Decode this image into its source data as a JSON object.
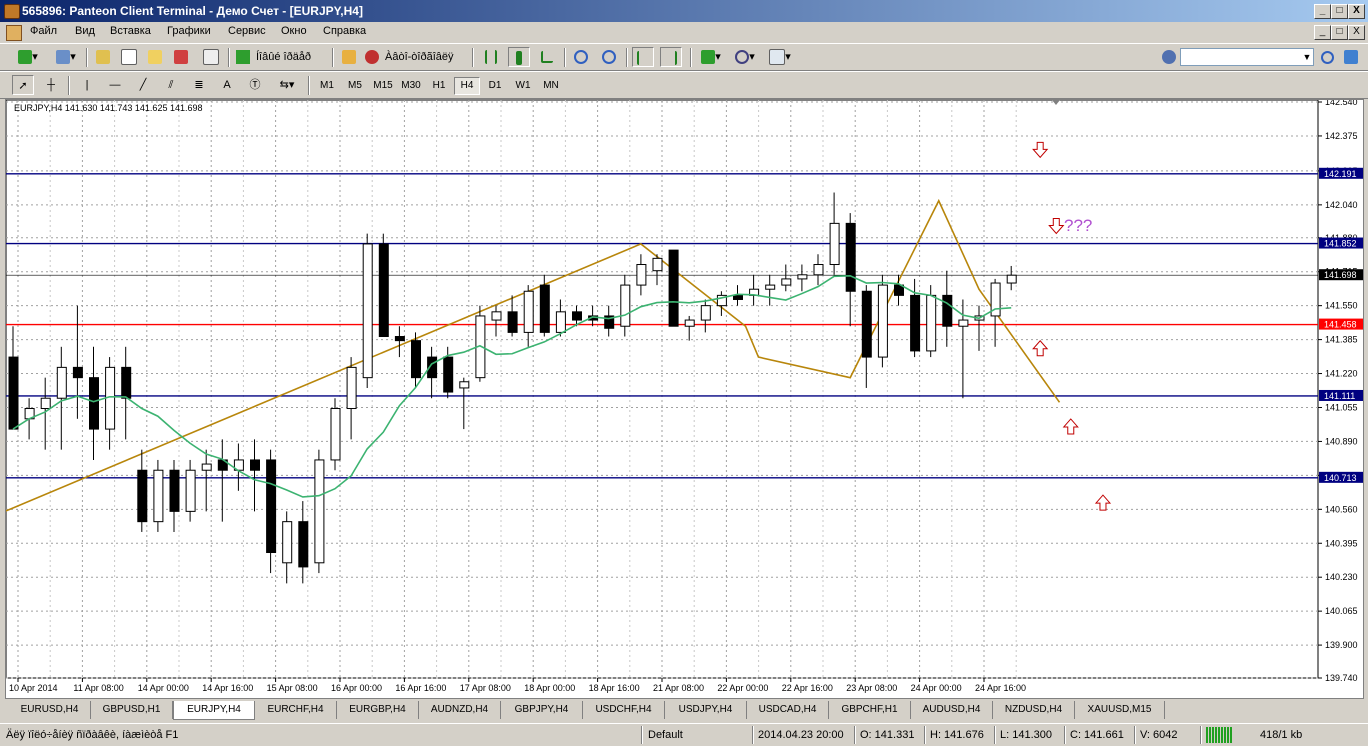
{
  "window": {
    "title": "565896: Panteon Client Terminal - Демо Счет - [EURJPY,H4]",
    "min_label": "_",
    "max_label": "□",
    "close_label": "X"
  },
  "menu": {
    "items": [
      "Файл",
      "Вид",
      "Вставка",
      "Графики",
      "Сервис",
      "Окно",
      "Справка"
    ]
  },
  "toolbar": {
    "new_order_label": "Íîâûé îðäåð",
    "autotrading_label": "Àâòî-òîðãîâëÿ",
    "timeframes": [
      "M1",
      "M5",
      "M15",
      "M30",
      "H1",
      "H4",
      "D1",
      "W1",
      "MN"
    ],
    "active_timeframe": "H4",
    "text_tool_label": "A"
  },
  "chart_data": {
    "type": "candlestick",
    "symbol_info": "EURJPY,H4  141.630 141.743 141.625 141.698",
    "y_ticks": [
      "142.540",
      "142.375",
      "142.205",
      "142.040",
      "141.880",
      "141.715",
      "141.550",
      "141.385",
      "141.220",
      "141.055",
      "140.890",
      "140.725",
      "140.560",
      "140.395",
      "140.230",
      "140.065",
      "139.900",
      "139.740"
    ],
    "ylim": [
      139.74,
      142.54
    ],
    "x_labels": [
      "10 Apr 2014",
      "11 Apr 08:00",
      "14 Apr 00:00",
      "14 Apr 16:00",
      "15 Apr 08:00",
      "16 Apr 00:00",
      "16 Apr 16:00",
      "17 Apr 08:00",
      "18 Apr 00:00",
      "18 Apr 16:00",
      "21 Apr 08:00",
      "22 Apr 00:00",
      "22 Apr 16:00",
      "23 Apr 08:00",
      "24 Apr 00:00",
      "24 Apr 16:00"
    ],
    "candles": [
      [
        141.3,
        141.45,
        140.95,
        140.95
      ],
      [
        141.0,
        141.1,
        140.9,
        141.05
      ],
      [
        141.05,
        141.2,
        140.85,
        141.1
      ],
      [
        141.1,
        141.35,
        140.85,
        141.25
      ],
      [
        141.25,
        141.55,
        141.0,
        141.2
      ],
      [
        141.2,
        141.35,
        140.8,
        140.95
      ],
      [
        140.95,
        141.3,
        140.85,
        141.25
      ],
      [
        141.25,
        141.35,
        140.9,
        141.1
      ],
      [
        140.75,
        140.85,
        140.45,
        140.5
      ],
      [
        140.5,
        140.8,
        140.45,
        140.75
      ],
      [
        140.75,
        140.8,
        140.45,
        140.55
      ],
      [
        140.55,
        140.8,
        140.5,
        140.75
      ],
      [
        140.75,
        140.85,
        140.55,
        140.78
      ],
      [
        140.8,
        140.9,
        140.5,
        140.75
      ],
      [
        140.75,
        140.88,
        140.65,
        140.8
      ],
      [
        140.8,
        140.9,
        140.55,
        140.75
      ],
      [
        140.8,
        140.85,
        140.25,
        140.35
      ],
      [
        140.3,
        140.55,
        140.2,
        140.5
      ],
      [
        140.5,
        140.6,
        140.2,
        140.28
      ],
      [
        140.3,
        140.85,
        140.25,
        140.8
      ],
      [
        140.8,
        141.1,
        140.75,
        141.05
      ],
      [
        141.05,
        141.3,
        140.9,
        141.25
      ],
      [
        141.2,
        141.9,
        141.15,
        141.85
      ],
      [
        141.85,
        141.9,
        141.4,
        141.4
      ],
      [
        141.4,
        141.45,
        141.3,
        141.38
      ],
      [
        141.38,
        141.42,
        141.15,
        141.2
      ],
      [
        141.3,
        141.35,
        141.1,
        141.2
      ],
      [
        141.3,
        141.35,
        141.1,
        141.13
      ],
      [
        141.15,
        141.2,
        140.95,
        141.18
      ],
      [
        141.2,
        141.55,
        141.18,
        141.5
      ],
      [
        141.48,
        141.55,
        141.4,
        141.52
      ],
      [
        141.52,
        141.6,
        141.4,
        141.42
      ],
      [
        141.42,
        141.65,
        141.35,
        141.62
      ],
      [
        141.65,
        141.7,
        141.4,
        141.42
      ],
      [
        141.42,
        141.58,
        141.4,
        141.52
      ],
      [
        141.52,
        141.55,
        141.45,
        141.48
      ],
      [
        141.5,
        141.55,
        141.45,
        141.48
      ],
      [
        141.5,
        141.55,
        141.4,
        141.44
      ],
      [
        141.45,
        141.7,
        141.4,
        141.65
      ],
      [
        141.65,
        141.8,
        141.6,
        141.75
      ],
      [
        141.72,
        141.8,
        141.65,
        141.78
      ],
      [
        141.82,
        141.8,
        141.45,
        141.45
      ],
      [
        141.45,
        141.5,
        141.38,
        141.48
      ],
      [
        141.48,
        141.58,
        141.42,
        141.55
      ],
      [
        141.55,
        141.62,
        141.5,
        141.6
      ],
      [
        141.6,
        141.65,
        141.55,
        141.58
      ],
      [
        141.6,
        141.7,
        141.55,
        141.63
      ],
      [
        141.63,
        141.7,
        141.55,
        141.65
      ],
      [
        141.65,
        141.75,
        141.62,
        141.68
      ],
      [
        141.68,
        141.75,
        141.62,
        141.7
      ],
      [
        141.7,
        141.8,
        141.65,
        141.75
      ],
      [
        141.75,
        142.1,
        141.7,
        141.95
      ],
      [
        141.95,
        142.0,
        141.45,
        141.62
      ],
      [
        141.62,
        141.65,
        141.15,
        141.3
      ],
      [
        141.3,
        141.7,
        141.25,
        141.65
      ],
      [
        141.65,
        141.7,
        141.55,
        141.6
      ],
      [
        141.6,
        141.68,
        141.3,
        141.33
      ],
      [
        141.33,
        141.65,
        141.3,
        141.6
      ],
      [
        141.6,
        141.72,
        141.35,
        141.45
      ],
      [
        141.45,
        141.58,
        141.1,
        141.48
      ],
      [
        141.48,
        141.55,
        141.33,
        141.5
      ],
      [
        141.5,
        141.68,
        141.35,
        141.66
      ],
      [
        141.66,
        141.743,
        141.625,
        141.698
      ]
    ],
    "ma_series_name": "",
    "hlines": [
      {
        "value": 142.191,
        "label": "142.191",
        "color": "#000080"
      },
      {
        "value": 141.852,
        "label": "141.852",
        "color": "#000080"
      },
      {
        "value": 141.698,
        "label": "141.698",
        "color": "#000000"
      },
      {
        "value": 141.458,
        "label": "141.458",
        "color": "#ff0000"
      },
      {
        "value": 141.111,
        "label": "141.111",
        "color": "#000080"
      },
      {
        "value": 140.713,
        "label": "140.713",
        "color": "#000080"
      }
    ],
    "annotation_text": "???",
    "annotation_color": "#b050d0",
    "arrow_color": "#c00000",
    "zigzag_color": "#b8860b",
    "ma_color": "#3cb371"
  },
  "tabs": {
    "items": [
      "EURUSD,H4",
      "GBPUSD,H1",
      "EURJPY,H4",
      "EURCHF,H4",
      "EURGBP,H4",
      "AUDNZD,H4",
      "GBPJPY,H4",
      "USDCHF,H4",
      "USDJPY,H4",
      "USDCAD,H4",
      "GBPCHF,H1",
      "AUDUSD,H4",
      "NZDUSD,H4",
      "XAUUSD,M15"
    ],
    "active": "EURJPY,H4"
  },
  "status": {
    "help": "Äëÿ ïîëó÷åíèÿ ñïðàâêè, íàæìèòå F1",
    "profile": "Default",
    "datetime": "2014.04.23 20:00",
    "open": "O: 141.331",
    "high": "H: 141.676",
    "low": "L: 141.300",
    "close": "C: 141.661",
    "volume": "V: 6042",
    "traffic": "418/1 kb"
  }
}
